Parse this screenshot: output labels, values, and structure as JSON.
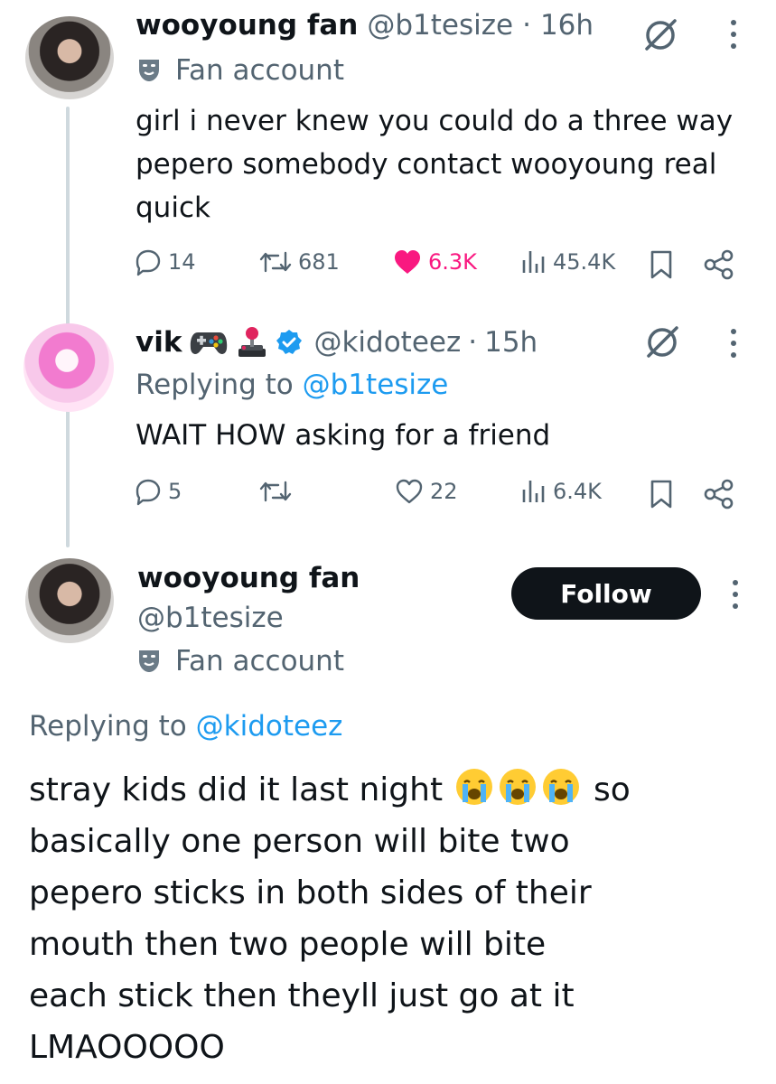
{
  "tweets": [
    {
      "display_name": "wooyoung fan",
      "handle": "@b1tesize",
      "separator": "·",
      "time": "16h",
      "badge_label": "Fan account",
      "text": "girl i never knew you could do a three way pepero somebody contact wooyoung real quick",
      "stats": {
        "replies": "14",
        "retweets": "681",
        "likes": "6.3K",
        "views": "45.4K"
      },
      "liked": true
    },
    {
      "display_name": "vik",
      "name_emojis": [
        "video-game-emoji",
        "joystick-emoji"
      ],
      "verified": true,
      "handle": "@kidoteez",
      "separator": "·",
      "time": "15h",
      "replying_prefix": "Replying to",
      "replying_handle": "@b1tesize",
      "text": "WAIT HOW asking for a friend",
      "stats": {
        "replies": "5",
        "retweets": "",
        "likes": "22",
        "views": "6.4K"
      },
      "liked": false
    }
  ],
  "main_tweet": {
    "display_name": "wooyoung fan",
    "handle": "@b1tesize",
    "badge_label": "Fan account",
    "follow_label": "Follow",
    "replying_prefix": "Replying to",
    "replying_handle": "@kidoteez",
    "text_part1": "stray kids did it last night",
    "text_part2": "so",
    "text_emojis": [
      "loudly-crying-face",
      "loudly-crying-face",
      "loudly-crying-face"
    ],
    "text_lines": [
      "basically one person will bite two",
      "pepero sticks in both sides of their",
      "mouth then two people will bite",
      "each stick then theyll just go at it",
      "LMAOOOOO"
    ]
  },
  "colors": {
    "text": "#0f1419",
    "muted": "#536471",
    "link": "#1d9bf0",
    "like": "#f91880",
    "verified": "#1d9bf0",
    "thread_line": "#cfd9de",
    "follow_bg": "#0f1419"
  }
}
